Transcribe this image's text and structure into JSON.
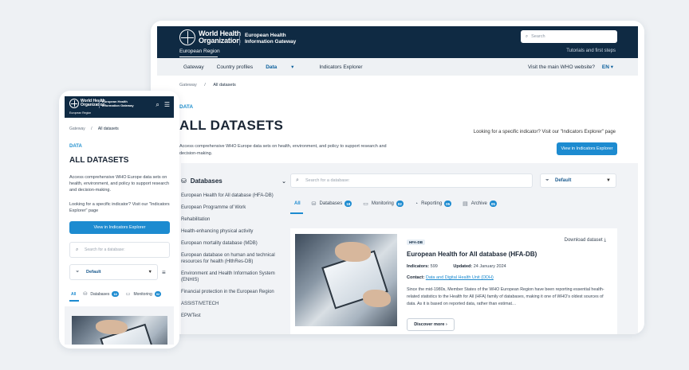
{
  "header": {
    "org_line1": "World Health",
    "org_line2": "Organization",
    "region": "European Region",
    "gateway_line1": "European Health",
    "gateway_line2": "Information Gateway",
    "search_placeholder": "Search",
    "tutorials": "Tutorials and first steps"
  },
  "nav": {
    "items": [
      "Gateway",
      "Country profiles",
      "Data",
      "Indicators Explorer"
    ],
    "data_chevron": "▾",
    "visit": "Visit the main WHO website?",
    "lang": "EN ▾"
  },
  "breadcrumb": {
    "root": "Gateway",
    "sep": "/",
    "current": "All datasets"
  },
  "page": {
    "kicker": "DATA",
    "title": "ALL DATASETS",
    "description_desktop": "Access comprehensive WHO Europe data sets on health, environment, and policy to support research and decision-making.",
    "description_mobile": "Access comprehensive WHO Europe data sets on health, environment, and policy to support research and decision-making.",
    "looking_for": "Looking for a specific indicator? Visit our \"Indicators Explorer\" page",
    "button": "View in Indicators Explorer"
  },
  "sidebar": {
    "title": "Databases",
    "items": [
      "European Health for All database (HFA-DB)",
      "European Programme of Work",
      "Rehabilitation",
      "Health-enhancing physical activity",
      "European mortality database (MDB)",
      "European database on human and technical resources for health (HlthRes-DB)",
      "Environment and Health Information System (ENHIS)",
      "Financial protection in the European Region",
      "ASSISTIVETECH",
      "EPWTest"
    ]
  },
  "filters": {
    "search_placeholder": "Search for a database:",
    "sort_value": "Default"
  },
  "tabs": [
    {
      "label": "All",
      "count": ""
    },
    {
      "label": "Databases",
      "count": "18"
    },
    {
      "label": "Monitoring",
      "count": "02"
    },
    {
      "label": "Reporting",
      "count": "05"
    },
    {
      "label": "Archive",
      "count": "05"
    }
  ],
  "card": {
    "tag": "HFA-DB",
    "download": "Download dataset",
    "title": "European Health for All database (HFA-DB)",
    "indicators_label": "Indicators:",
    "indicators_value": "599",
    "updated_label": "Updated:",
    "updated_value": "24 January 2024",
    "contact_label": "Contact:",
    "contact_value": "Data and Digital Health Unit (DDH)",
    "summary": "Since the mid-1980s, Member States of the WHO European Region have been reporting essential health-related statistics to the Health for All (HFA) family of databases, making it one of WHO's oldest sources of data. As it is based on reported data, rather than estimat…",
    "more": "Discover more"
  }
}
